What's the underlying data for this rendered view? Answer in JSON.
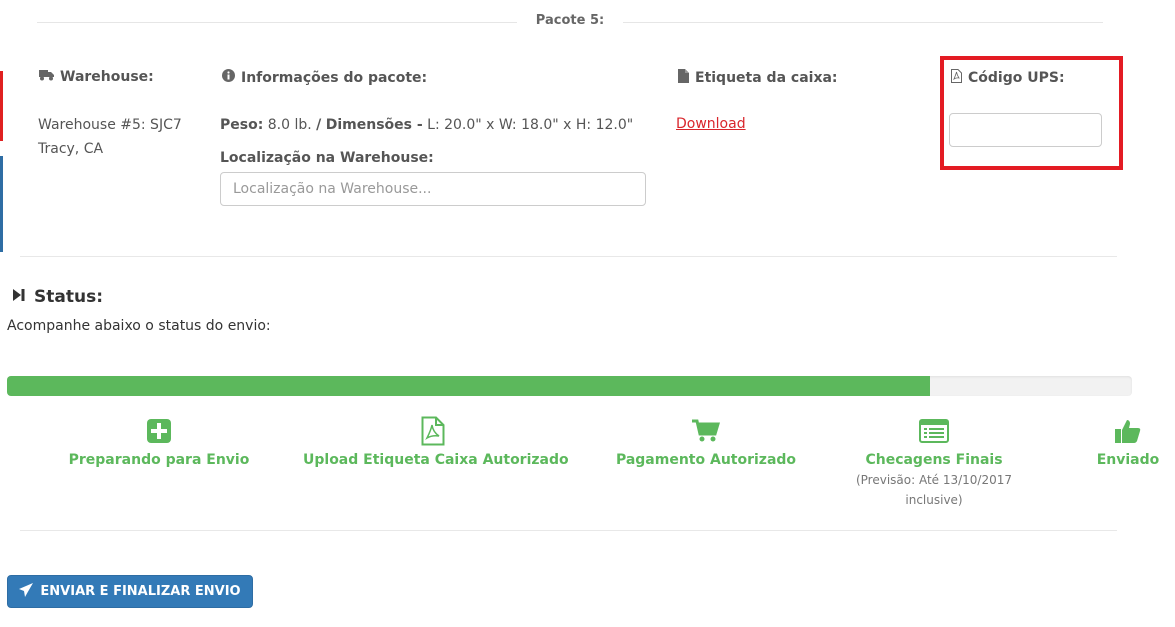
{
  "package": {
    "title": "Pacote 5:"
  },
  "warehouse": {
    "label": "Warehouse:",
    "line1": "Warehouse #5: SJC7",
    "line2": "Tracy, CA"
  },
  "package_info": {
    "label": "Informações do pacote:",
    "weight_label": "Peso:",
    "weight_value": "8.0 lb.",
    "separator": "/",
    "dimensions_label": "Dimensões -",
    "dimensions_value": "L: 20.0\" x W: 18.0\" x H: 12.0\"",
    "location_label": "Localização na Warehouse:",
    "location_placeholder": "Localização na Warehouse...",
    "location_value": ""
  },
  "box_label": {
    "label": "Etiqueta da caixa:",
    "download_text": "Download"
  },
  "ups_code": {
    "label": "Código UPS:",
    "value": ""
  },
  "status": {
    "title": "Status:",
    "subtitle": "Acompanhe abaixo o status do envio:",
    "progress_fraction": 0.82,
    "steps": [
      {
        "name": "Preparando para Envio",
        "icon": "plus-square-icon"
      },
      {
        "name": "Upload Etiqueta Caixa Autorizado",
        "icon": "pdf-file-icon"
      },
      {
        "name": "Pagamento Autorizado",
        "icon": "shopping-cart-icon"
      },
      {
        "name": "Checagens Finais",
        "icon": "list-alt-icon",
        "note_line1": "(Previsão: Até 13/10/2017",
        "note_line2": "inclusive)"
      },
      {
        "name": "Enviado",
        "icon": "thumbs-up-icon"
      }
    ]
  },
  "submit_button": {
    "label": "ENVIAR E FINALIZAR ENVIO",
    "icon": "paper-plane-icon"
  },
  "colors": {
    "success": "#5cb85c",
    "primary": "#337ab7",
    "highlight": "#e31b23",
    "link": "#d9262c"
  }
}
